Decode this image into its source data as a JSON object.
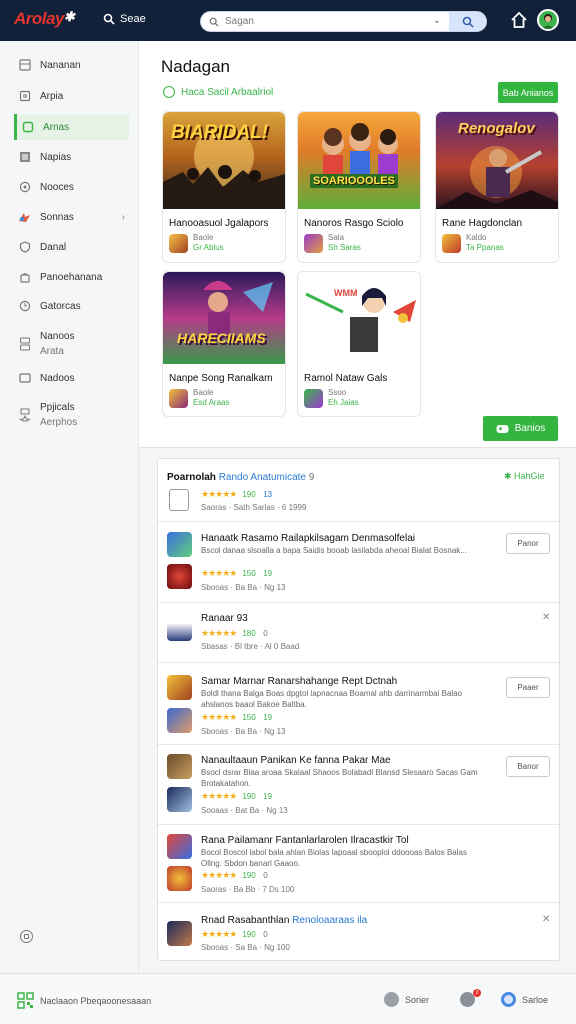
{
  "app": {
    "logo_text": "Arolay",
    "logo_mark": "✱"
  },
  "topbar": {
    "search_label": "Seae",
    "search_placeholder": "Sagan",
    "search_arrow": "⌄"
  },
  "sidebar": {
    "items": [
      {
        "label": "Nananan",
        "icon": "grid-icon"
      },
      {
        "label": "Arpia",
        "icon": "box-icon"
      },
      {
        "label": "Arnas",
        "icon": "gamepad-icon",
        "active": true
      },
      {
        "label": "Napias",
        "icon": "image-icon"
      },
      {
        "label": "Nooces",
        "icon": "circle-icon"
      },
      {
        "label": "Sonnas",
        "icon": "controller-icon"
      },
      {
        "label": "Danal",
        "icon": "shield-icon"
      },
      {
        "label": "Panoehanana",
        "icon": "bag-icon"
      },
      {
        "label": "Gatorcas",
        "icon": "clock-icon"
      },
      {
        "label": "Nanoos",
        "label2": "Arata",
        "icon": "book-icon"
      },
      {
        "label": "Nadoos",
        "icon": "tv-icon"
      },
      {
        "label": "Ppjicals",
        "label2": "Aerphos",
        "icon": "puzzle-icon"
      }
    ],
    "chevron": "›"
  },
  "main": {
    "title": "Nadagan",
    "subtitle": "Haca Sacil Arbaalriol",
    "small_button": "Bab Anianos",
    "large_button": "Banios",
    "games": [
      {
        "name": "Hanooasuol Jgalapors",
        "thumb_text": "BIARIDAL!",
        "meta1": "Baole",
        "meta2": "Gr Ablus"
      },
      {
        "name": "Nanoros Rasgo Sciolo",
        "thumb_text": "SOARIOOOLES",
        "meta1": "Sala",
        "meta2": "Sh Saras"
      },
      {
        "name": "Rane Hagdonclan",
        "thumb_text": "Renogalov",
        "meta1": "Kaldo",
        "meta2": "Ta Ppanas"
      },
      {
        "name": "Nanpe Song Ranalkam",
        "thumb_text": "HARECIIAMS",
        "meta1": "Baole",
        "meta2": "Esd Araas"
      },
      {
        "name": "Ramol Nataw Gals",
        "thumb_text": "WMM",
        "meta1": "Ssoo",
        "meta2": "Eh Jaias"
      }
    ]
  },
  "list": {
    "rows": [
      {
        "title": "Poarnolah",
        "link": "Rando Anatumicate",
        "tag": "9",
        "desc": "",
        "stars": "★★★★★",
        "rating": "190",
        "badge": "13",
        "meta": "Saoras · Sath Sarlas · 6 1999",
        "right": "check",
        "right_text": "✱ HahGie"
      },
      {
        "title": "Hanaatk Rasamo Railapkilsagam Denmasolfelai",
        "desc": "Bscol danaa slsoalla a bapa Saidis booab lasilabda aheoal Bialat Bosnak...",
        "stars": "★★★★★",
        "rating": "150",
        "badge": "19",
        "meta": "Sbooas · Ba Ba · Ng 13",
        "right": "button",
        "right_text": "Panor"
      },
      {
        "title": "Ranaar 93",
        "desc": "",
        "stars": "★★★★★",
        "rating": "180",
        "badge": "0",
        "meta": "Sbasas · Bl tbre · Al 0 Baad",
        "right": "x",
        "right_text": "✕"
      },
      {
        "title": "Samar Marnar Ranarshahange Rept Dctnah",
        "desc": "Boldl thana Balga Boas dpgtol lapnacnaa Boamal ahb darrinarmbai Balao ahslanos baaol Bakoe Baltba.",
        "stars": "★★★★★",
        "rating": "150",
        "badge": "19",
        "meta": "Sbooas · Ba Ba · Ng 13",
        "right": "button",
        "right_text": "Paaer"
      },
      {
        "title": "Nanaultaaun Panikan Ke fanna Pakar Mae",
        "desc": "Bsocl dsrar Blaa aroaa Skalaal Shaoos Bolabadl Blansd Slesaaro Sacas Gam Brotakatahon.",
        "stars": "★★★★★",
        "rating": "190",
        "badge": "19",
        "meta": "Sooaas · Bat Ba · Ng 13",
        "right": "button",
        "right_text": "Banor"
      },
      {
        "title": "Rana Pailamanr Fantanlarlarolen Ilracastkir Tol",
        "desc": "Bocol Boscol labol bala ahlan Biolas lapoaal sbooplol ddoooas Balos Balas Ollng. Sbdon banarl Gaaoo.",
        "stars": "★★★★★",
        "rating": "190",
        "badge": "0",
        "meta": "Saoras · Ba Bb · 7 Ds 100",
        "right": "none",
        "right_text": ""
      },
      {
        "title": "Rnad Rasabanthlan",
        "link": "Renoloaaraas ila",
        "desc": "",
        "stars": "★★★★★",
        "rating": "190",
        "badge": "0",
        "meta": "Sbooas · Sa Ba · Ng 100",
        "right": "x",
        "right_text": "✕"
      }
    ]
  },
  "footer": {
    "left_label": "Naclaaon Pbeqaoonesaaan",
    "mid_label": "Sorier",
    "notif_count": "2",
    "right_label": "Sarloe"
  },
  "colors": {
    "topbar": "#12213a",
    "accent": "#3bb54a",
    "logo_red": "#e5342e",
    "star": "#f2b01e"
  }
}
